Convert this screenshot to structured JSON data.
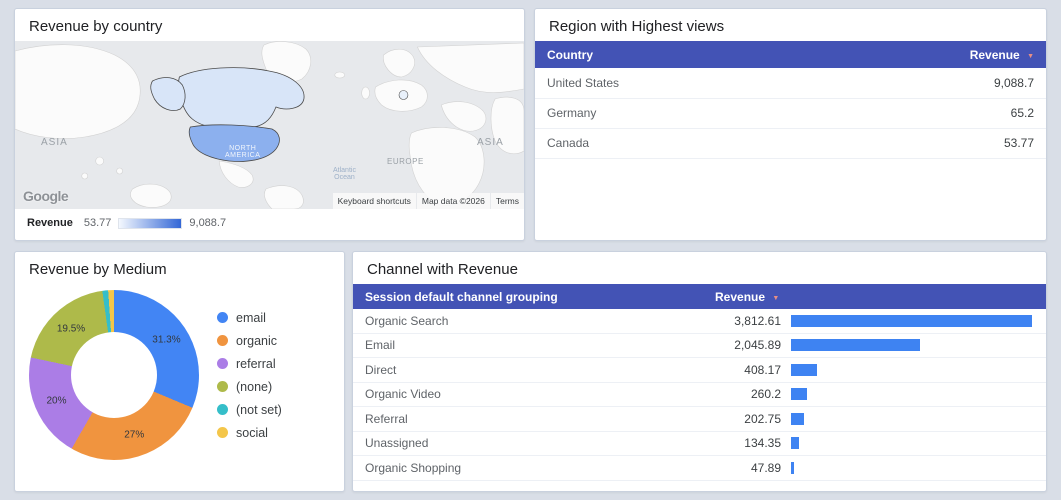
{
  "map_panel": {
    "title": "Revenue by country",
    "labels": {
      "asia_left": "ASIA",
      "asia_right": "ASIA",
      "europe": "EUROPE",
      "north_america": "NORTH\nAMERICA",
      "atlantic_ocean": "Atlantic\nOcean"
    },
    "google_logo": "Google",
    "footer": {
      "keyboard_shortcuts": "Keyboard shortcuts",
      "map_data": "Map data ©2026",
      "terms": "Terms"
    },
    "legend": {
      "label": "Revenue",
      "min": "53.77",
      "max": "9,088.7",
      "min_color": "#f4f8fe",
      "max_color": "#3367d6"
    }
  },
  "region_panel": {
    "title": "Region with Highest views",
    "columns": {
      "country": "Country",
      "revenue": "Revenue",
      "sort_icon": "▼"
    },
    "rows": [
      {
        "country": "United States",
        "revenue": "9,088.7"
      },
      {
        "country": "Germany",
        "revenue": "65.2"
      },
      {
        "country": "Canada",
        "revenue": "53.77"
      }
    ]
  },
  "medium_panel": {
    "title": "Revenue by Medium",
    "slices": [
      {
        "label": "email",
        "pct": 31.3,
        "display": "31.3%",
        "color": "#4285f4"
      },
      {
        "label": "organic",
        "pct": 27.0,
        "display": "27%",
        "color": "#f0943f"
      },
      {
        "label": "referral",
        "pct": 20.0,
        "display": "20%",
        "color": "#ab7de6"
      },
      {
        "label": "(none)",
        "pct": 19.5,
        "display": "19.5%",
        "color": "#aeba4a"
      },
      {
        "label": "(not set)",
        "pct": 1.1,
        "display": "",
        "color": "#35bec9"
      },
      {
        "label": "social",
        "pct": 1.1,
        "display": "",
        "color": "#f4c64a"
      }
    ]
  },
  "channel_panel": {
    "title": "Channel with Revenue",
    "columns": {
      "channel": "Session default channel grouping",
      "revenue": "Revenue",
      "sort_icon": "▼"
    },
    "bar_color": "#3e83f2",
    "max_value": 3812.61,
    "rows": [
      {
        "channel": "Organic Search",
        "revenue": "3,812.61",
        "value": 3812.61
      },
      {
        "channel": "Email",
        "revenue": "2,045.89",
        "value": 2045.89
      },
      {
        "channel": "Direct",
        "revenue": "408.17",
        "value": 408.17
      },
      {
        "channel": "Organic Video",
        "revenue": "260.2",
        "value": 260.2
      },
      {
        "channel": "Referral",
        "revenue": "202.75",
        "value": 202.75
      },
      {
        "channel": "Unassigned",
        "revenue": "134.35",
        "value": 134.35
      },
      {
        "channel": "Organic Shopping",
        "revenue": "47.89",
        "value": 47.89
      }
    ]
  },
  "chart_data": [
    {
      "type": "heatmap",
      "subtype": "geo-map",
      "title": "Revenue by country",
      "series": [
        {
          "name": "Revenue",
          "points": [
            {
              "country": "United States",
              "value": 9088.7
            },
            {
              "country": "Germany",
              "value": 65.2
            },
            {
              "country": "Canada",
              "value": 53.77
            }
          ]
        }
      ],
      "value_range": [
        53.77,
        9088.7
      ],
      "legend_position": "bottom"
    },
    {
      "type": "table",
      "title": "Region with Highest views",
      "columns": [
        "Country",
        "Revenue"
      ],
      "rows": [
        [
          "United States",
          9088.7
        ],
        [
          "Germany",
          65.2
        ],
        [
          "Canada",
          53.77
        ]
      ],
      "sort": {
        "column": "Revenue",
        "direction": "desc"
      }
    },
    {
      "type": "pie",
      "subtype": "donut",
      "title": "Revenue by Medium",
      "categories": [
        "email",
        "organic",
        "referral",
        "(none)",
        "(not set)",
        "social"
      ],
      "values": [
        31.3,
        27,
        20,
        19.5,
        1.1,
        1.1
      ],
      "unit": "%",
      "legend_position": "right"
    },
    {
      "type": "bar",
      "orientation": "horizontal",
      "title": "Channel with Revenue",
      "categories": [
        "Organic Search",
        "Email",
        "Direct",
        "Organic Video",
        "Referral",
        "Unassigned",
        "Organic Shopping"
      ],
      "values": [
        3812.61,
        2045.89,
        408.17,
        260.2,
        202.75,
        134.35,
        47.89
      ],
      "xlabel": "Revenue",
      "ylabel": "Session default channel grouping",
      "xlim": [
        0,
        3812.61
      ]
    }
  ]
}
